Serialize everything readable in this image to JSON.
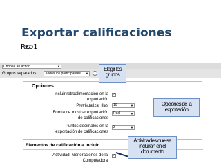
{
  "title": "Exportar calificaciones",
  "step": "Paso 1",
  "toolbar": {
    "action_select": "Choose an action ...",
    "group_label": "Grupos separados",
    "participants_select": "Todos los participantes",
    "help_icon": "question-mark-icon"
  },
  "options": {
    "heading": "Opciones",
    "feedback_label_line1": "Incluir retroalimentación en la",
    "feedback_label_line2": "exportación",
    "feedback_checked": true,
    "preview_label": "Previsualizar filas",
    "preview_value": "10",
    "format_label_line1": "Forma de mostrar exportación",
    "format_label_line2": "de calificaciones",
    "format_value": "Real",
    "decimals_label_line1": "Puntos decimales en la",
    "decimals_label_line2": "exportación de calificaciones",
    "decimals_value": "2"
  },
  "items_section": {
    "heading": "Elementos de calificación a incluir",
    "activity_label_line1": "Actividad: Generaciones de la",
    "activity_label_line2": "Computadora",
    "activity_checked": true
  },
  "callouts": {
    "groups": "Elegir los grupos",
    "export_options": "Opciones de la exportación",
    "activities": "Actividades que se incluirán en el documento"
  },
  "colors": {
    "title": "#24496e",
    "callout_fill": "#d6e2f4",
    "callout_border": "#6d8fc4",
    "leader": "#1a2f66"
  }
}
